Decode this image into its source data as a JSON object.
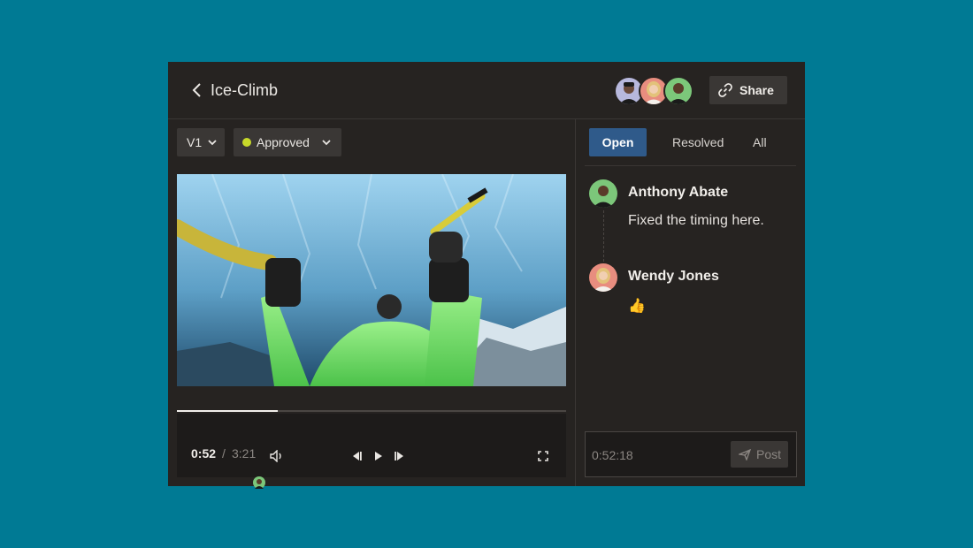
{
  "header": {
    "back_icon": "chevron-left-icon",
    "title": "Ice-Climb",
    "collaborators": [
      "collaborator-avatar-1",
      "collaborator-avatar-2",
      "collaborator-avatar-3"
    ],
    "share_label": "Share",
    "share_icon": "link-icon"
  },
  "player": {
    "version_label": "V1",
    "status_label": "Approved",
    "status_color": "#c7d92a",
    "current_time": "0:52",
    "separator": "/",
    "total_time": "3:21",
    "progress": 0.26,
    "icons": [
      "volume-icon",
      "step-back-icon",
      "play-icon",
      "step-forward-icon",
      "fullscreen-icon"
    ]
  },
  "comments_panel": {
    "tabs": [
      {
        "label": "Open",
        "active": true
      },
      {
        "label": "Resolved",
        "active": false
      },
      {
        "label": "All",
        "active": false
      }
    ],
    "comments": [
      {
        "author": "Anthony Abate",
        "text": "Fixed the timing here."
      },
      {
        "author": "Wendy Jones",
        "text": "👍"
      }
    ],
    "reply": {
      "placeholder": "0:52:18",
      "post_label": "Post",
      "post_icon": "send-icon"
    }
  },
  "colors": {
    "background": "#007a94",
    "panel": "#262321",
    "accent_tab": "#2f5a8a"
  }
}
